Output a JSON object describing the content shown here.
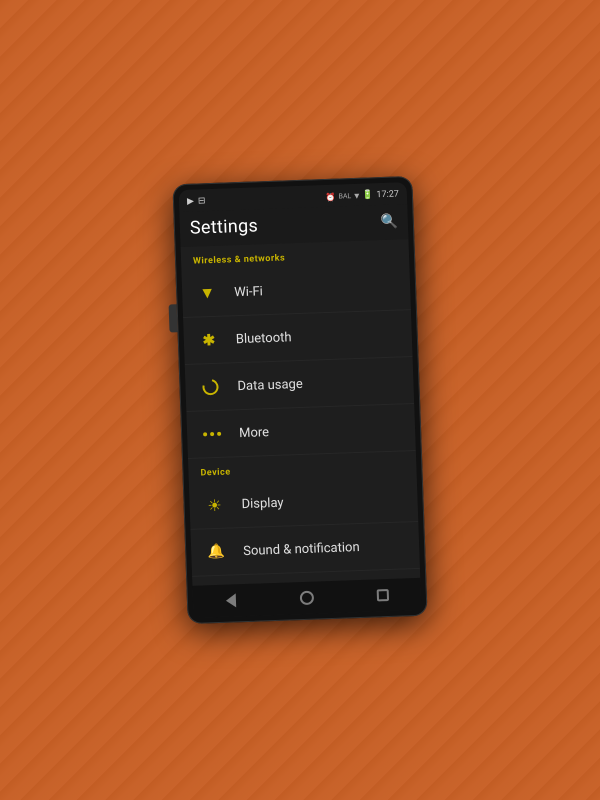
{
  "phone": {
    "status_bar": {
      "left_icons": [
        "media-icon",
        "sim-icon"
      ],
      "time": "17:27",
      "bal_label": "BAL"
    },
    "header": {
      "title": "Settings",
      "search_label": "search"
    },
    "sections": [
      {
        "id": "wireless",
        "label": "Wireless & networks",
        "items": [
          {
            "id": "wifi",
            "label": "Wi-Fi",
            "icon": "wifi"
          },
          {
            "id": "bluetooth",
            "label": "Bluetooth",
            "icon": "bluetooth"
          },
          {
            "id": "data-usage",
            "label": "Data usage",
            "icon": "data"
          },
          {
            "id": "more",
            "label": "More",
            "icon": "more"
          }
        ]
      },
      {
        "id": "device",
        "label": "Device",
        "items": [
          {
            "id": "display",
            "label": "Display",
            "icon": "display"
          },
          {
            "id": "sound",
            "label": "Sound & notification",
            "icon": "sound"
          }
        ]
      }
    ],
    "nav": {
      "back_label": "back",
      "home_label": "home",
      "recent_label": "recent"
    }
  }
}
